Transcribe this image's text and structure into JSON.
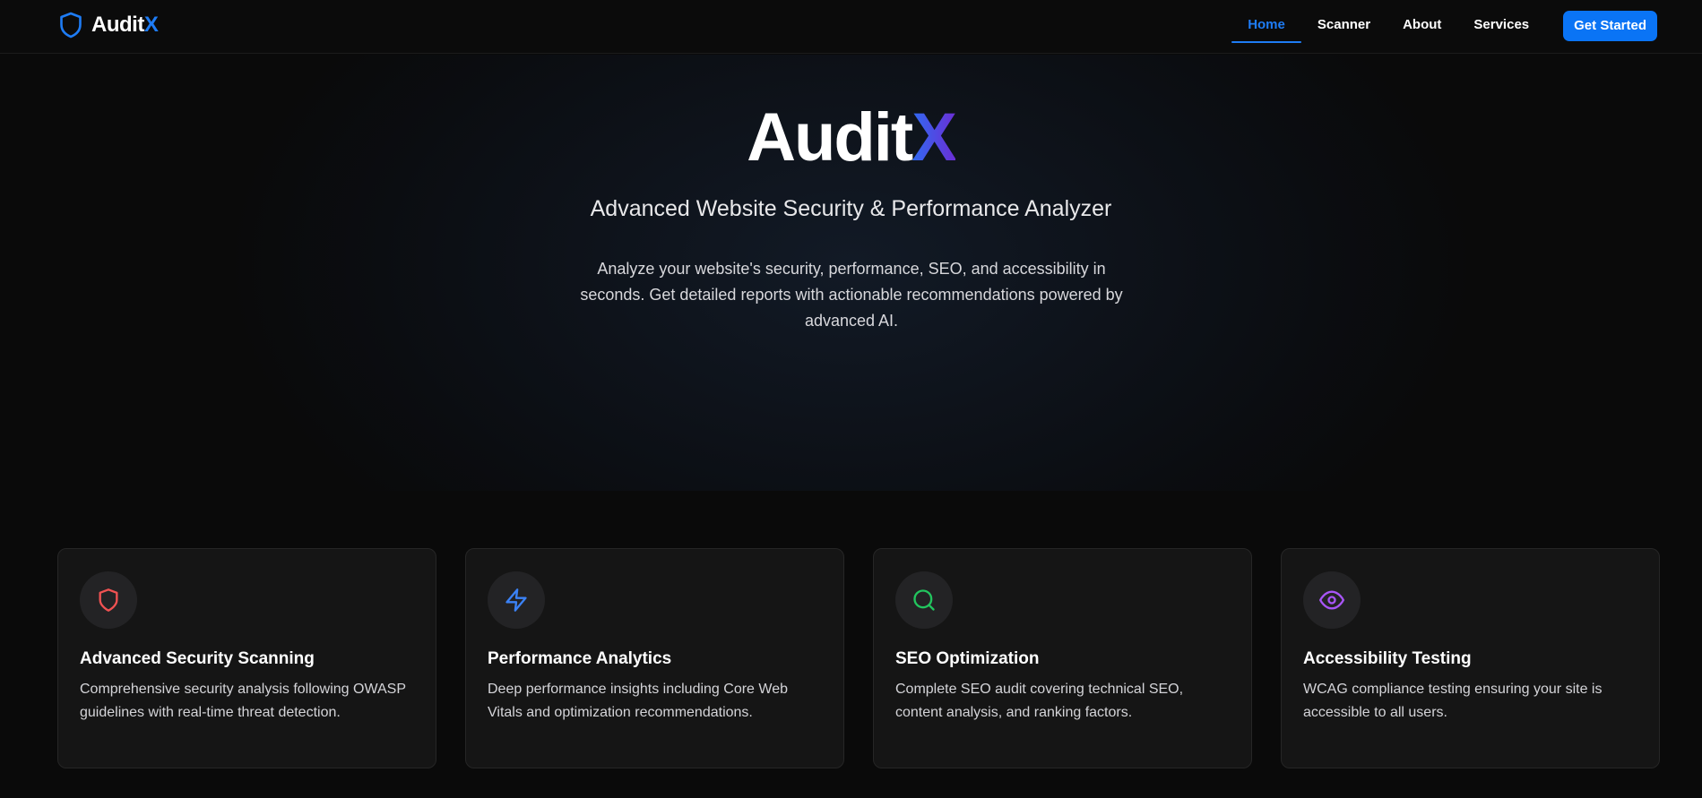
{
  "header": {
    "brand": {
      "name_main": "Audit",
      "name_accent": "X",
      "icon": "shield-icon"
    },
    "nav": [
      {
        "label": "Home",
        "active": true
      },
      {
        "label": "Scanner",
        "active": false
      },
      {
        "label": "About",
        "active": false
      },
      {
        "label": "Services",
        "active": false
      }
    ],
    "cta_label": "Get Started"
  },
  "hero": {
    "title_main": "Audit",
    "title_accent": "X",
    "subtitle": "Advanced Website Security & Performance Analyzer",
    "description": "Analyze your website's security, performance, SEO, and accessibility in seconds. Get detailed reports with actionable recommendations powered by advanced AI."
  },
  "features": [
    {
      "icon": "shield-icon",
      "icon_color": "#f05252",
      "title": "Advanced Security Scanning",
      "description": "Comprehensive security analysis following OWASP guidelines with real-time threat detection."
    },
    {
      "icon": "lightning-icon",
      "icon_color": "#3b82f6",
      "title": "Performance Analytics",
      "description": "Deep performance insights including Core Web Vitals and optimization recommendations."
    },
    {
      "icon": "search-icon",
      "icon_color": "#22c55e",
      "title": "SEO Optimization",
      "description": "Complete SEO audit covering technical SEO, content analysis, and ranking factors."
    },
    {
      "icon": "eye-icon",
      "icon_color": "#a855f7",
      "title": "Accessibility Testing",
      "description": "WCAG compliance testing ensuring your site is accessible to all users."
    }
  ],
  "colors": {
    "background": "#0a0a0a",
    "accent_blue": "#1e7cf5",
    "title_gradient_start": "#2f6bf2",
    "title_gradient_end": "#6b2fd6"
  }
}
